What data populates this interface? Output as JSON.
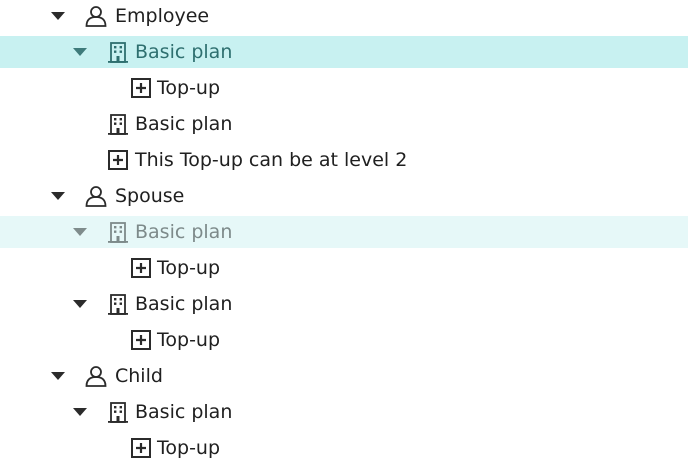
{
  "tree": {
    "employee": {
      "label": "Employee",
      "icon": "person-icon",
      "children": [
        {
          "label": "Basic plan",
          "icon": "building-icon",
          "state": "selected",
          "children": [
            {
              "label": "Top-up",
              "icon": "plus-box-icon"
            }
          ]
        },
        {
          "label": "Basic plan",
          "icon": "building-icon"
        },
        {
          "label": "This Top-up can be at level 2",
          "icon": "plus-box-icon"
        }
      ]
    },
    "spouse": {
      "label": "Spouse",
      "icon": "person-icon",
      "children": [
        {
          "label": "Basic plan",
          "icon": "building-icon",
          "state": "hover",
          "children": [
            {
              "label": "Top-up",
              "icon": "plus-box-icon"
            }
          ]
        },
        {
          "label": "Basic plan",
          "icon": "building-icon",
          "children": [
            {
              "label": "Top-up",
              "icon": "plus-box-icon"
            }
          ]
        }
      ]
    },
    "child": {
      "label": "Child",
      "icon": "person-icon",
      "children": [
        {
          "label": "Basic plan",
          "icon": "building-icon",
          "children": [
            {
              "label": "Top-up",
              "icon": "plus-box-icon"
            }
          ]
        }
      ]
    }
  },
  "colors": {
    "selected_bg": "#c8f1f1",
    "hover_bg": "#e6f8f8",
    "text": "#202020",
    "selected_text": "#2e6f6f"
  }
}
